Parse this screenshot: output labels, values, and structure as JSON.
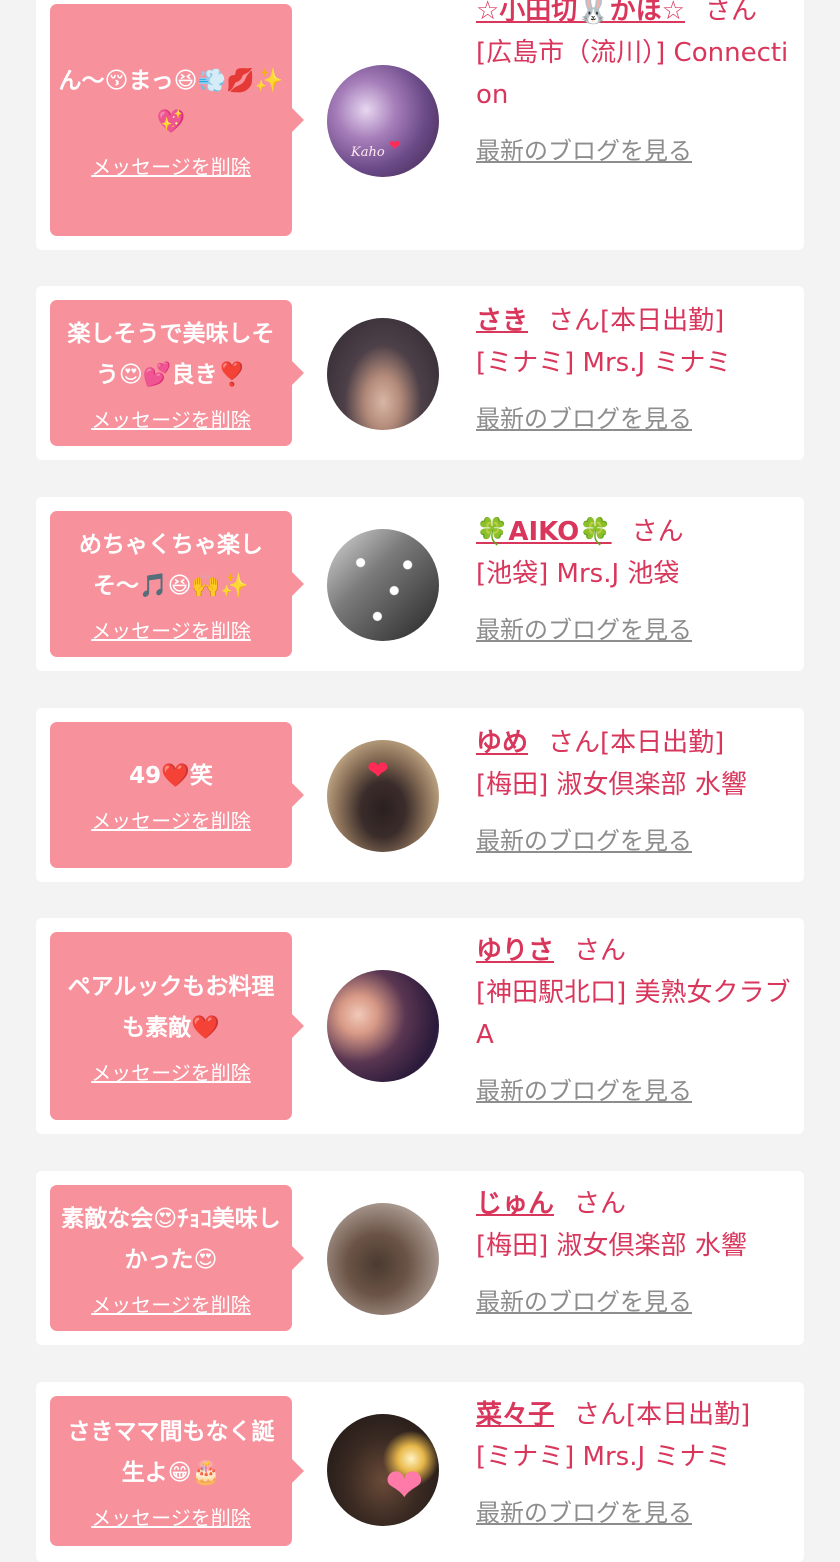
{
  "colors": {
    "background": "#f3f3f3",
    "card": "#ffffff",
    "bubble": "#f7919c",
    "accent": "#d9365c",
    "muted_link": "#8d8d8d"
  },
  "entries": [
    {
      "message": "ん〜😚まっ😆💨💋✨💖",
      "delete_label": "メッセージを削除",
      "name": "☆小田切🐰かほ☆",
      "san": "さん",
      "status": "",
      "shop": "[広島市（流川）] Connection",
      "blog_label": "最新のブログを見る",
      "avatar_text": "Kaho"
    },
    {
      "message": "楽しそうで美味しそう😍💕良き❣️",
      "delete_label": "メッセージを削除",
      "name": "さき",
      "san": "さん",
      "status": "[本日出勤]",
      "shop": "[ミナミ] Mrs.J ミナミ",
      "blog_label": "最新のブログを見る"
    },
    {
      "message": "めちゃくちゃ楽しそ〜🎵😆🙌✨",
      "delete_label": "メッセージを削除",
      "name": "🍀AIKO🍀",
      "san": "さん",
      "status": "",
      "shop": "[池袋] Mrs.J 池袋",
      "blog_label": "最新のブログを見る"
    },
    {
      "message": "49❤️笑",
      "delete_label": "メッセージを削除",
      "name": "ゆめ",
      "san": "さん",
      "status": "[本日出勤]",
      "shop": "[梅田] 淑女倶楽部 水響",
      "blog_label": "最新のブログを見る"
    },
    {
      "message": "ペアルックもお料理も素敵❤️",
      "delete_label": "メッセージを削除",
      "name": "ゆりさ",
      "san": "さん",
      "status": "",
      "shop": "[神田駅北口] 美熟女クラブA",
      "blog_label": "最新のブログを見る"
    },
    {
      "message": "素敵な会😍ﾁｮｺ美味しかった😍",
      "delete_label": "メッセージを削除",
      "name": "じゅん",
      "san": "さん",
      "status": "",
      "shop": "[梅田] 淑女倶楽部 水響",
      "blog_label": "最新のブログを見る"
    },
    {
      "message": "さきママ間もなく誕生よ😁🎂",
      "delete_label": "メッセージを削除",
      "name": "菜々子",
      "san": "さん",
      "status": "[本日出勤]",
      "shop": "[ミナミ] Mrs.J ミナミ",
      "blog_label": "最新のブログを見る"
    }
  ]
}
